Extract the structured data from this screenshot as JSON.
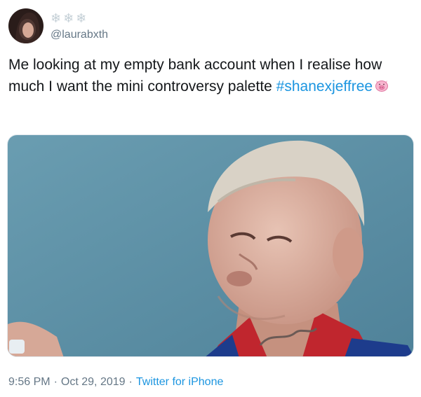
{
  "user": {
    "display_name": "❄❄❄",
    "handle": "@laurabxth"
  },
  "tweet": {
    "text_main": "Me looking at my empty bank account when I realise how much I want the mini controversy palette ",
    "hashtag": "#shanexjeffree",
    "emoji": "pig-face-icon",
    "media_alt_icon": "photo-of-person-icon"
  },
  "meta": {
    "time": "9:56 PM",
    "date": "Oct 29, 2019",
    "separator": "·",
    "source": "Twitter for iPhone"
  },
  "colors": {
    "link": "#1b95e0",
    "secondary_text": "#657786",
    "media_bg": "#5f93a8"
  }
}
